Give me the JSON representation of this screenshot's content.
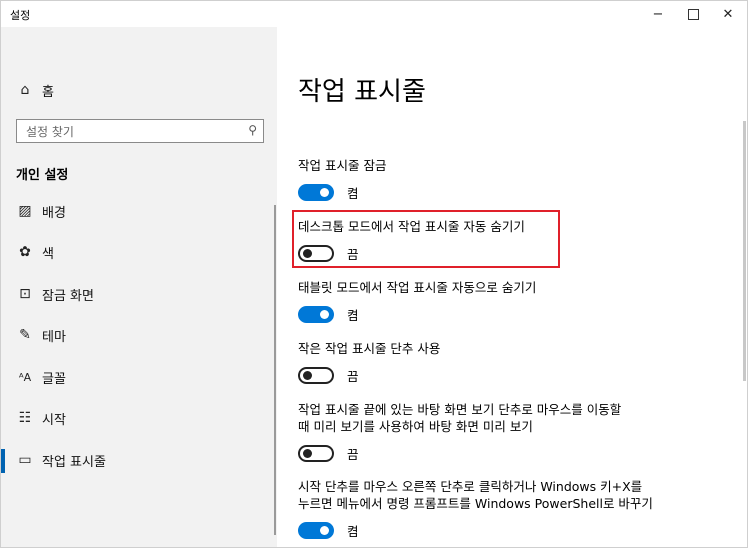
{
  "window": {
    "title": "설정",
    "controls": {
      "minimize": "−",
      "close": "✕"
    }
  },
  "sidebar": {
    "home": {
      "label": "홈",
      "icon": "home-icon",
      "glyph": "⌂"
    },
    "search": {
      "placeholder": "설정 찾기",
      "icon": "search-icon",
      "glyph": "⚲"
    },
    "group_title": "개인 설정",
    "items": [
      {
        "label": "배경",
        "icon": "image-icon",
        "glyph": "▨"
      },
      {
        "label": "색",
        "icon": "palette-icon",
        "glyph": "✿"
      },
      {
        "label": "잠금 화면",
        "icon": "lock-screen-icon",
        "glyph": "⊡"
      },
      {
        "label": "테마",
        "icon": "theme-icon",
        "glyph": "✎"
      },
      {
        "label": "글꼴",
        "icon": "font-icon",
        "glyph": "ᴬA"
      },
      {
        "label": "시작",
        "icon": "start-icon",
        "glyph": "☷"
      },
      {
        "label": "작업 표시줄",
        "icon": "taskbar-icon",
        "glyph": "▭",
        "active": true
      }
    ]
  },
  "main": {
    "title": "작업 표시줄",
    "settings": [
      {
        "label": "작업 표시줄 잠금",
        "on": true,
        "state": "켬"
      },
      {
        "label": "데스크톱 모드에서 작업 표시줄 자동 숨기기",
        "on": false,
        "state": "끔",
        "highlighted": true
      },
      {
        "label": "태블릿 모드에서 작업 표시줄 자동으로 숨기기",
        "on": true,
        "state": "켬"
      },
      {
        "label": "작은 작업 표시줄 단추 사용",
        "on": false,
        "state": "끔"
      },
      {
        "label": "작업 표시줄 끝에 있는 바탕 화면 보기 단추로 마우스를 이동할",
        "label2": "때 미리 보기를 사용하여 바탕 화면 미리 보기",
        "on": false,
        "state": "끔"
      },
      {
        "label": "시작 단추를 마우스 오른쪽 단추로 클릭하거나 Windows 키+X를",
        "label2": "누르면 메뉴에서 명령 프롬프트를 Windows PowerShell로 바꾸기",
        "on": true,
        "state": "켬"
      }
    ]
  },
  "colors": {
    "accent": "#0078d7",
    "highlight": "#e0202a",
    "sidebar_bg": "#f2f2f2"
  }
}
